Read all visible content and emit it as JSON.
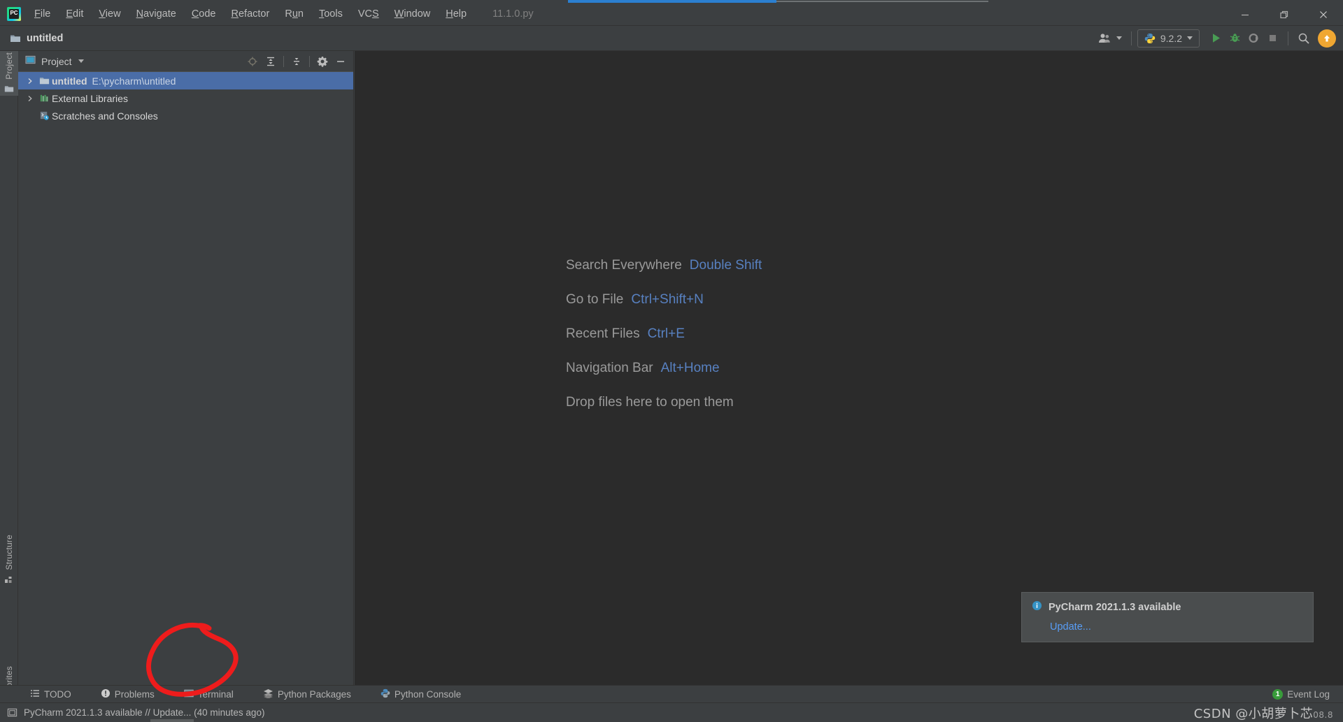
{
  "window": {
    "app_name": "PyCharm",
    "file_tab": "11.1.0.py",
    "minimize": "Minimize",
    "restore": "Restore",
    "close": "Close"
  },
  "menubar": {
    "items": [
      {
        "label": "File",
        "mnemonic": "F"
      },
      {
        "label": "Edit",
        "mnemonic": "E"
      },
      {
        "label": "View",
        "mnemonic": "V"
      },
      {
        "label": "Navigate",
        "mnemonic": "N"
      },
      {
        "label": "Code",
        "mnemonic": "C"
      },
      {
        "label": "Refactor",
        "mnemonic": "R"
      },
      {
        "label": "Run",
        "mnemonic": "u"
      },
      {
        "label": "Tools",
        "mnemonic": "T"
      },
      {
        "label": "VCS",
        "mnemonic": "S"
      },
      {
        "label": "Window",
        "mnemonic": "W"
      },
      {
        "label": "Help",
        "mnemonic": "H"
      }
    ]
  },
  "toolbar": {
    "project_name": "untitled",
    "interpreter": "9.2.2",
    "buttons": [
      {
        "name": "user-settings",
        "label": "User"
      },
      {
        "name": "run",
        "label": "Run"
      },
      {
        "name": "debug",
        "label": "Debug"
      },
      {
        "name": "coverage",
        "label": "Run with Coverage"
      },
      {
        "name": "stop",
        "label": "Stop"
      },
      {
        "name": "search",
        "label": "Search Everywhere"
      },
      {
        "name": "update",
        "label": "Update"
      }
    ]
  },
  "left_tool_tabs": [
    {
      "label": "Project",
      "icon": "folder-icon",
      "active": true
    },
    {
      "label": "Structure",
      "icon": "structure-icon",
      "active": false
    },
    {
      "label": "Favorites",
      "icon": "star-icon",
      "active": false
    }
  ],
  "project_panel": {
    "title": "Project",
    "header_buttons": [
      {
        "name": "locate-icon",
        "label": "Select Opened File"
      },
      {
        "name": "expand-all-icon",
        "label": "Expand All"
      },
      {
        "name": "collapse-all-icon",
        "label": "Collapse All"
      },
      {
        "name": "settings-gear-icon",
        "label": "Options"
      },
      {
        "name": "hide-icon",
        "label": "Hide"
      }
    ],
    "tree": [
      {
        "name": "untitled",
        "path": "E:\\pycharm\\untitled",
        "icon": "folder-icon",
        "expandable": true,
        "selected": true
      },
      {
        "name": "External Libraries",
        "path": "",
        "icon": "library-icon",
        "expandable": true,
        "selected": false
      },
      {
        "name": "Scratches and Consoles",
        "path": "",
        "icon": "scratches-icon",
        "expandable": false,
        "selected": false
      }
    ]
  },
  "editor": {
    "welcome_rows": [
      {
        "label": "Search Everywhere",
        "shortcut": "Double Shift"
      },
      {
        "label": "Go to File",
        "shortcut": "Ctrl+Shift+N"
      },
      {
        "label": "Recent Files",
        "shortcut": "Ctrl+E"
      },
      {
        "label": "Navigation Bar",
        "shortcut": "Alt+Home"
      },
      {
        "label": "Drop files here to open them",
        "shortcut": ""
      }
    ]
  },
  "notification": {
    "title": "PyCharm 2021.1.3 available",
    "link": "Update...",
    "icon": "info-icon"
  },
  "bottom_bar": {
    "items": [
      {
        "label": "TODO",
        "icon": "todo-icon"
      },
      {
        "label": "Problems",
        "icon": "problems-icon"
      },
      {
        "label": "Terminal",
        "icon": "terminal-icon",
        "highlighted": true
      },
      {
        "label": "Python Packages",
        "icon": "packages-icon"
      },
      {
        "label": "Python Console",
        "icon": "python-icon"
      }
    ],
    "event_log": {
      "label": "Event Log",
      "count": "1"
    }
  },
  "status_bar": {
    "message": "PyCharm 2021.1.3 available // Update... (40 minutes ago)",
    "icon": "memory-icon",
    "watermark": "CSDN @小胡萝卜芯",
    "watermark_suffix": "08.8"
  },
  "colors": {
    "panel_bg": "#3c3f41",
    "editor_bg": "#2b2b2b",
    "selection": "#4a6da7",
    "link_blue": "#5881c1",
    "accent_orange": "#f0a732",
    "run_green": "#499c54",
    "annotation_red": "#ee1c1c"
  }
}
